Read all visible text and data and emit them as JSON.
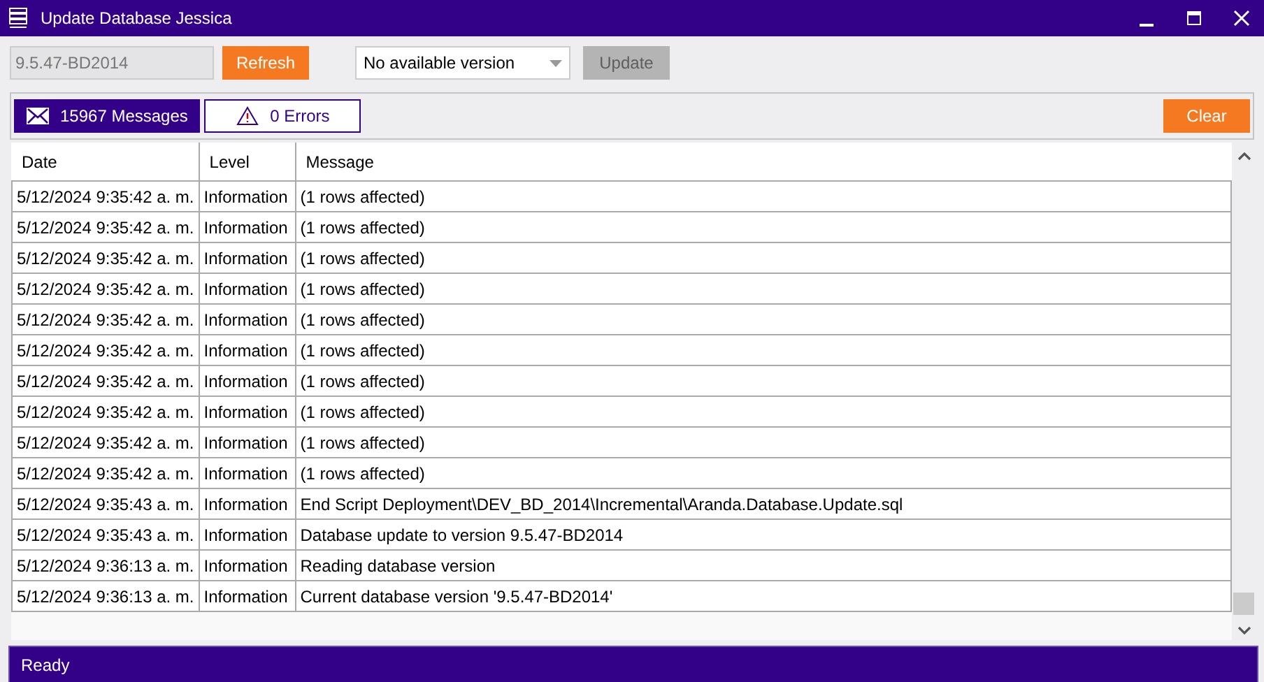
{
  "window": {
    "title": "Update Database Jessica"
  },
  "toolbar": {
    "current_version": "9.5.47-BD2014",
    "refresh_button": "Refresh",
    "version_select": "No available version",
    "update_button": {
      "label": "Update",
      "disabled": true
    }
  },
  "tabs": [
    {
      "label": "15967 Messages",
      "kind": "messages",
      "selected": true
    },
    {
      "label": "0 Errors",
      "kind": "errors",
      "selected": false
    }
  ],
  "clear_button": "Clear",
  "table": {
    "columns": [
      "Date",
      "Level",
      "Message"
    ],
    "rows": [
      [
        "5/12/2024 9:35:42 a. m.",
        "Information",
        "(1 rows affected)"
      ],
      [
        "5/12/2024 9:35:42 a. m.",
        "Information",
        "(1 rows affected)"
      ],
      [
        "5/12/2024 9:35:42 a. m.",
        "Information",
        "(1 rows affected)"
      ],
      [
        "5/12/2024 9:35:42 a. m.",
        "Information",
        "(1 rows affected)"
      ],
      [
        "5/12/2024 9:35:42 a. m.",
        "Information",
        "(1 rows affected)"
      ],
      [
        "5/12/2024 9:35:42 a. m.",
        "Information",
        "(1 rows affected)"
      ],
      [
        "5/12/2024 9:35:42 a. m.",
        "Information",
        "(1 rows affected)"
      ],
      [
        "5/12/2024 9:35:42 a. m.",
        "Information",
        "(1 rows affected)"
      ],
      [
        "5/12/2024 9:35:42 a. m.",
        "Information",
        "(1 rows affected)"
      ],
      [
        "5/12/2024 9:35:42 a. m.",
        "Information",
        "(1 rows affected)"
      ],
      [
        "5/12/2024 9:35:43 a. m.",
        "Information",
        "End Script Deployment\\DEV_BD_2014\\Incremental\\Aranda.Database.Update.sql"
      ],
      [
        "5/12/2024 9:35:43 a. m.",
        "Information",
        "Database update to version 9.5.47-BD2014"
      ],
      [
        "5/12/2024 9:36:13 a. m.",
        "Information",
        "Reading database version"
      ],
      [
        "5/12/2024 9:36:13 a. m.",
        "Information",
        "Current database version '9.5.47-BD2014'"
      ]
    ]
  },
  "status_bar": "Ready"
}
